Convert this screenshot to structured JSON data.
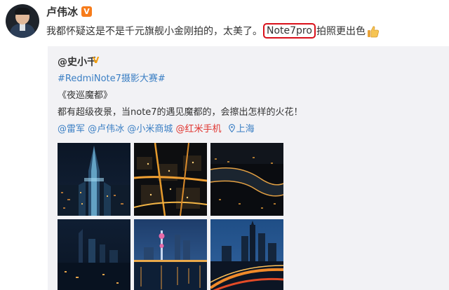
{
  "author": {
    "name": "卢伟冰",
    "badge": "V"
  },
  "post": {
    "text_before": "我都怀疑这是不是千元旗舰小金刚拍的，太美了。",
    "highlight": "Note7pro",
    "text_after": "拍照更出色",
    "emoji": "thumbs-up-icon"
  },
  "repost": {
    "author": "@史小千",
    "badge": "V",
    "hashtag": "#RedmiNote7摄影大赛#",
    "title": "《夜巡魔都》",
    "body": "都有超级夜景，当note7的遇见魔都的，会擦出怎样的火花！",
    "mentions": [
      "@雷军",
      "@卢伟冰",
      "@小米商城",
      "@红米手机"
    ],
    "location": "上海"
  },
  "photos": [
    "night-tower-photo",
    "night-city-aerial-photo",
    "night-river-bend-photo",
    "night-skyline-blue-photo",
    "night-bund-reflection-photo",
    "night-highway-skyline-photo"
  ],
  "colors": {
    "link": "#3b7fc4",
    "mention_red": "#e0342f",
    "highlight_box": "#d9101a",
    "verified_badge": "#f77c1b",
    "repost_bg": "#f2f2f5"
  }
}
